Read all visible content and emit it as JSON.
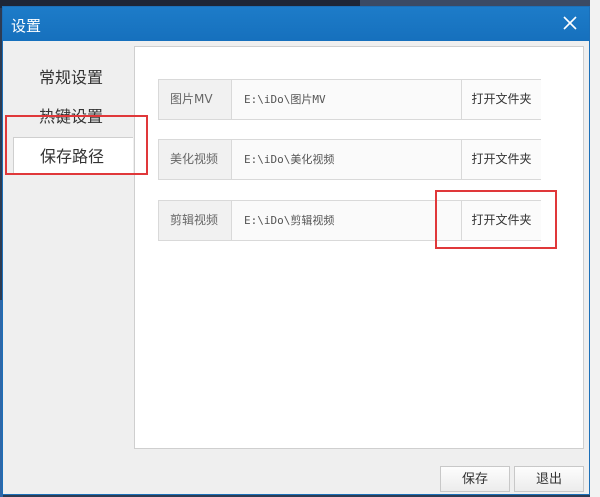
{
  "window": {
    "title": "设置",
    "close_icon": "close-icon"
  },
  "sidebar": {
    "items": [
      {
        "label": "常规设置",
        "active": false
      },
      {
        "label": "热键设置",
        "active": false
      },
      {
        "label": "保存路径",
        "active": true
      }
    ]
  },
  "paths": [
    {
      "label": "图片MV",
      "value": "E:\\iDo\\图片MV",
      "button": "打开文件夹"
    },
    {
      "label": "美化视频",
      "value": "E:\\iDo\\美化视频",
      "button": "打开文件夹"
    },
    {
      "label": "剪辑视频",
      "value": "E:\\iDo\\剪辑视频",
      "button": "打开文件夹"
    }
  ],
  "footer": {
    "save_label": "保存",
    "exit_label": "退出"
  },
  "colors": {
    "titlebar": "#1670bd",
    "highlight": "#e0383a"
  }
}
